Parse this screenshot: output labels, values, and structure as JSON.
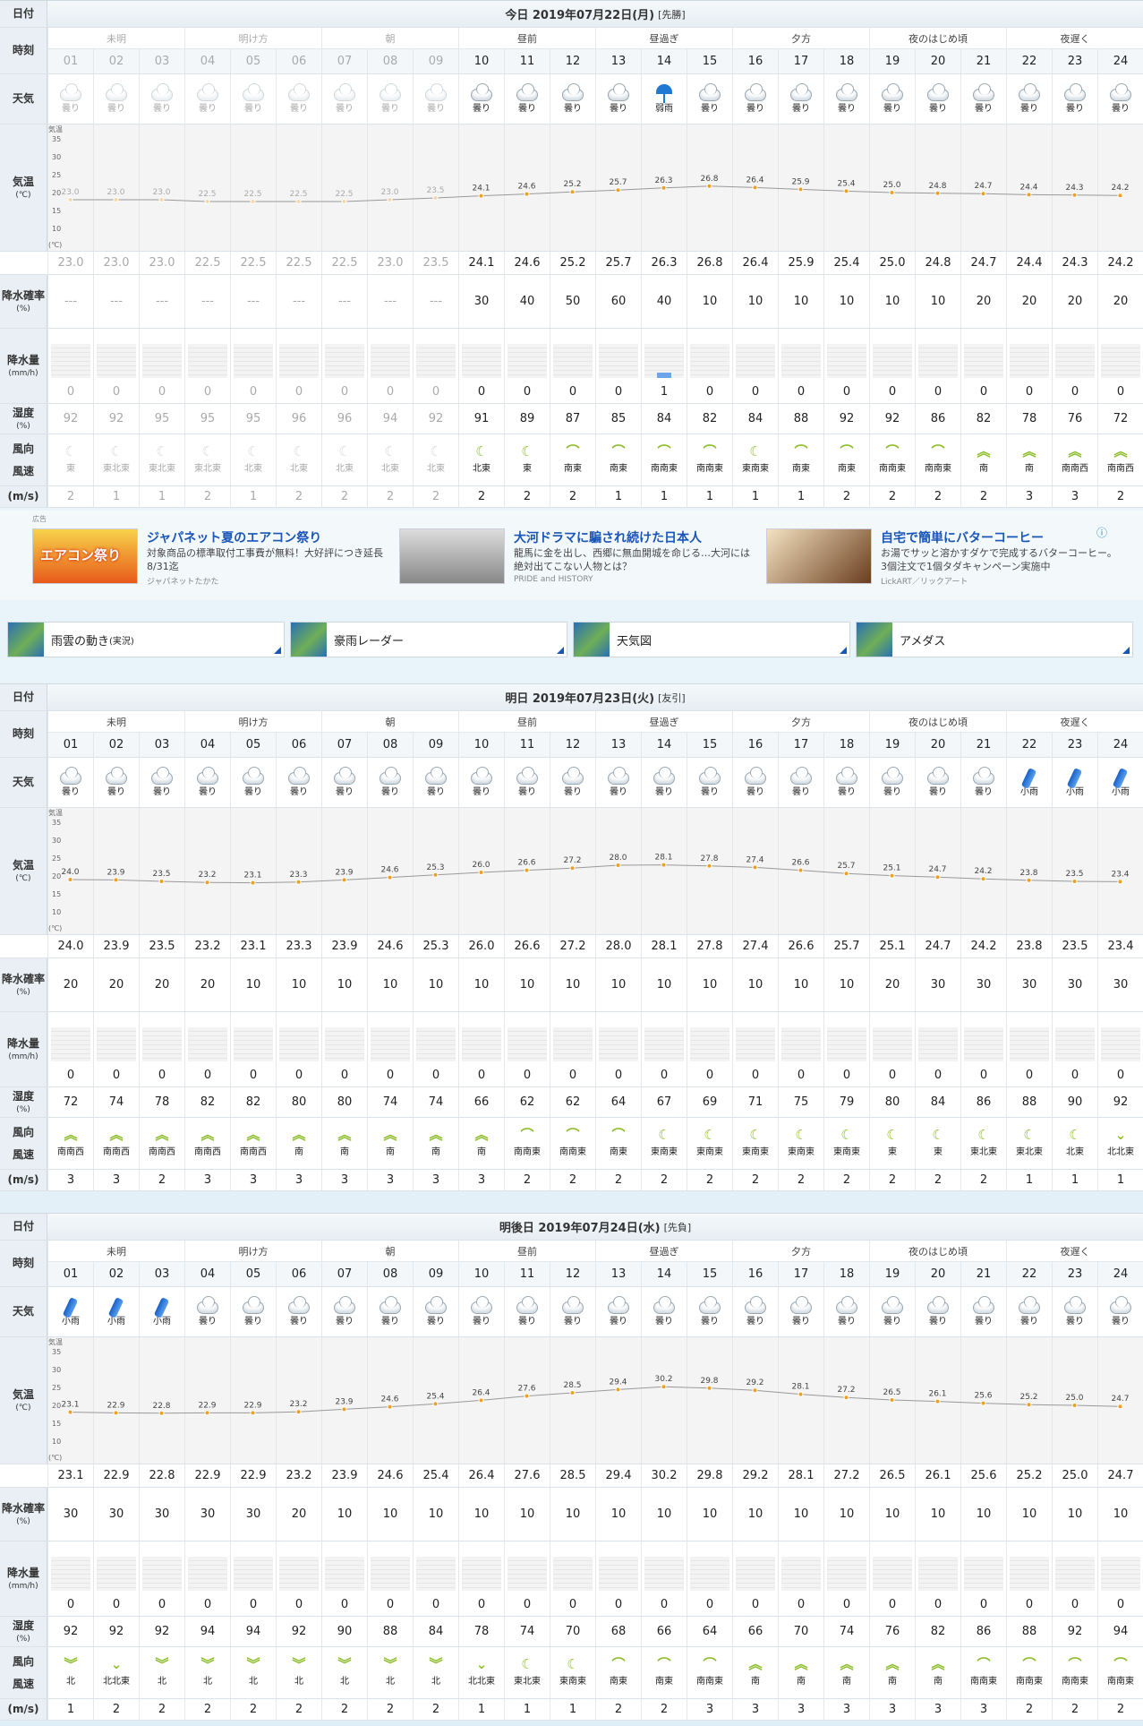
{
  "labels": {
    "date": "日付",
    "hour": "時刻",
    "weather": "天気",
    "temp": "気温",
    "temp_unit": "(℃)",
    "axis_title": "気温",
    "axis_unit": "(℃)",
    "pop": "降水確率",
    "pop_unit": "(%)",
    "rain": "降水量",
    "rain_unit": "(mm/h)",
    "humid": "湿度",
    "humid_unit": "(%)",
    "wdir": "風向",
    "wspd": "風速",
    "wunit": "(m/s)"
  },
  "periods": [
    "未明",
    "明け方",
    "朝",
    "昼前",
    "昼過ぎ",
    "夕方",
    "夜のはじめ頃",
    "夜遅く"
  ],
  "hours": [
    "01",
    "02",
    "03",
    "04",
    "05",
    "06",
    "07",
    "08",
    "09",
    "10",
    "11",
    "12",
    "13",
    "14",
    "15",
    "16",
    "17",
    "18",
    "19",
    "20",
    "21",
    "22",
    "23",
    "24"
  ],
  "axis_ticks": [
    "35",
    "30",
    "25",
    "20",
    "15",
    "10"
  ],
  "days": [
    {
      "title": "今日 2019年07月22日(月)",
      "rokuyo": "[先勝]",
      "past_hours": 9,
      "weather": [
        "曇り",
        "曇り",
        "曇り",
        "曇り",
        "曇り",
        "曇り",
        "曇り",
        "曇り",
        "曇り",
        "曇り",
        "曇り",
        "曇り",
        "曇り",
        "弱雨",
        "曇り",
        "曇り",
        "曇り",
        "曇り",
        "曇り",
        "曇り",
        "曇り",
        "曇り",
        "曇り",
        "曇り"
      ],
      "temp": [
        "23.0",
        "23.0",
        "23.0",
        "22.5",
        "22.5",
        "22.5",
        "22.5",
        "23.0",
        "23.5",
        "24.1",
        "24.6",
        "25.2",
        "25.7",
        "26.3",
        "26.8",
        "26.4",
        "25.9",
        "25.4",
        "25.0",
        "24.8",
        "24.7",
        "24.4",
        "24.3",
        "24.2"
      ],
      "pop": [
        "---",
        "---",
        "---",
        "---",
        "---",
        "---",
        "---",
        "---",
        "---",
        "30",
        "40",
        "50",
        "60",
        "40",
        "10",
        "10",
        "10",
        "10",
        "10",
        "10",
        "20",
        "20",
        "20",
        "20"
      ],
      "rain": [
        "0",
        "0",
        "0",
        "0",
        "0",
        "0",
        "0",
        "0",
        "0",
        "0",
        "0",
        "0",
        "0",
        "1",
        "0",
        "0",
        "0",
        "0",
        "0",
        "0",
        "0",
        "0",
        "0",
        "0"
      ],
      "humid": [
        "92",
        "92",
        "95",
        "95",
        "95",
        "96",
        "96",
        "94",
        "92",
        "91",
        "89",
        "87",
        "85",
        "84",
        "82",
        "84",
        "88",
        "92",
        "92",
        "86",
        "82",
        "78",
        "76",
        "72"
      ],
      "wdir": [
        "東",
        "東北東",
        "東北東",
        "東北東",
        "北東",
        "北東",
        "北東",
        "北東",
        "北東",
        "北東",
        "東",
        "南東",
        "南東",
        "南南東",
        "南南東",
        "東南東",
        "南東",
        "南東",
        "南南東",
        "南南東",
        "南",
        "南",
        "南南西",
        "南南西"
      ],
      "wspd": [
        "2",
        "1",
        "1",
        "2",
        "1",
        "2",
        "2",
        "2",
        "2",
        "2",
        "2",
        "2",
        "1",
        "1",
        "1",
        "1",
        "1",
        "2",
        "2",
        "2",
        "2",
        "3",
        "3",
        "2"
      ]
    },
    {
      "title": "明日 2019年07月23日(火)",
      "rokuyo": "[友引]",
      "past_hours": 0,
      "weather": [
        "曇り",
        "曇り",
        "曇り",
        "曇り",
        "曇り",
        "曇り",
        "曇り",
        "曇り",
        "曇り",
        "曇り",
        "曇り",
        "曇り",
        "曇り",
        "曇り",
        "曇り",
        "曇り",
        "曇り",
        "曇り",
        "曇り",
        "曇り",
        "曇り",
        "小雨",
        "小雨",
        "小雨"
      ],
      "temp": [
        "24.0",
        "23.9",
        "23.5",
        "23.2",
        "23.1",
        "23.3",
        "23.9",
        "24.6",
        "25.3",
        "26.0",
        "26.6",
        "27.2",
        "28.0",
        "28.1",
        "27.8",
        "27.4",
        "26.6",
        "25.7",
        "25.1",
        "24.7",
        "24.2",
        "23.8",
        "23.5",
        "23.4"
      ],
      "pop": [
        "20",
        "20",
        "20",
        "20",
        "10",
        "10",
        "10",
        "10",
        "10",
        "10",
        "10",
        "10",
        "10",
        "10",
        "10",
        "10",
        "10",
        "10",
        "20",
        "30",
        "30",
        "30",
        "30",
        "30"
      ],
      "rain": [
        "0",
        "0",
        "0",
        "0",
        "0",
        "0",
        "0",
        "0",
        "0",
        "0",
        "0",
        "0",
        "0",
        "0",
        "0",
        "0",
        "0",
        "0",
        "0",
        "0",
        "0",
        "0",
        "0",
        "0"
      ],
      "humid": [
        "72",
        "74",
        "78",
        "82",
        "82",
        "80",
        "80",
        "74",
        "74",
        "66",
        "62",
        "62",
        "64",
        "67",
        "69",
        "71",
        "75",
        "79",
        "80",
        "84",
        "86",
        "88",
        "90",
        "92"
      ],
      "wdir": [
        "南南西",
        "南南西",
        "南南西",
        "南南西",
        "南南西",
        "南",
        "南",
        "南",
        "南",
        "南",
        "南南東",
        "南南東",
        "南東",
        "東南東",
        "東南東",
        "東南東",
        "東南東",
        "東南東",
        "東",
        "東",
        "東北東",
        "東北東",
        "北東",
        "北北東"
      ],
      "wspd": [
        "3",
        "3",
        "2",
        "3",
        "3",
        "3",
        "3",
        "3",
        "3",
        "3",
        "2",
        "2",
        "2",
        "2",
        "2",
        "2",
        "2",
        "2",
        "2",
        "2",
        "2",
        "1",
        "1",
        "1"
      ]
    },
    {
      "title": "明後日 2019年07月24日(水)",
      "rokuyo": "[先負]",
      "past_hours": 0,
      "weather": [
        "小雨",
        "小雨",
        "小雨",
        "曇り",
        "曇り",
        "曇り",
        "曇り",
        "曇り",
        "曇り",
        "曇り",
        "曇り",
        "曇り",
        "曇り",
        "曇り",
        "曇り",
        "曇り",
        "曇り",
        "曇り",
        "曇り",
        "曇り",
        "曇り",
        "曇り",
        "曇り",
        "曇り"
      ],
      "temp": [
        "23.1",
        "22.9",
        "22.8",
        "22.9",
        "22.9",
        "23.2",
        "23.9",
        "24.6",
        "25.4",
        "26.4",
        "27.6",
        "28.5",
        "29.4",
        "30.2",
        "29.8",
        "29.2",
        "28.1",
        "27.2",
        "26.5",
        "26.1",
        "25.6",
        "25.2",
        "25.0",
        "24.7"
      ],
      "pop": [
        "30",
        "30",
        "30",
        "30",
        "30",
        "20",
        "10",
        "10",
        "10",
        "10",
        "10",
        "10",
        "10",
        "10",
        "10",
        "10",
        "10",
        "10",
        "10",
        "10",
        "10",
        "10",
        "10",
        "10"
      ],
      "rain": [
        "0",
        "0",
        "0",
        "0",
        "0",
        "0",
        "0",
        "0",
        "0",
        "0",
        "0",
        "0",
        "0",
        "0",
        "0",
        "0",
        "0",
        "0",
        "0",
        "0",
        "0",
        "0",
        "0",
        "0"
      ],
      "humid": [
        "92",
        "92",
        "92",
        "94",
        "94",
        "92",
        "90",
        "88",
        "84",
        "78",
        "74",
        "70",
        "68",
        "66",
        "64",
        "66",
        "70",
        "74",
        "76",
        "82",
        "86",
        "88",
        "92",
        "94"
      ],
      "wdir": [
        "北",
        "北北東",
        "北",
        "北",
        "北",
        "北",
        "北",
        "北",
        "北",
        "北北東",
        "東北東",
        "東南東",
        "南東",
        "南東",
        "南南東",
        "南",
        "南",
        "南",
        "南",
        "南",
        "南南東",
        "南南東",
        "南南東",
        "南南東"
      ],
      "wspd": [
        "1",
        "2",
        "2",
        "2",
        "2",
        "2",
        "2",
        "2",
        "2",
        "1",
        "1",
        "1",
        "2",
        "2",
        "3",
        "3",
        "3",
        "3",
        "3",
        "3",
        "3",
        "2",
        "2",
        "2"
      ]
    }
  ],
  "ads": {
    "label": "広告",
    "items": [
      {
        "title": "ジャパネット夏のエアコン祭り",
        "desc": "対象商品の標準取付工事費が無料！大好評につき延長 8/31迄",
        "source": "ジャパネットたかた",
        "thumb_text": "エアコン祭り"
      },
      {
        "title": "大河ドラマに騙され続けた日本人",
        "desc": "龍馬に金を出し、西郷に無血開城を命じる…大河には絶対出てこない人物とは？",
        "source": "PRIDE and HISTORY"
      },
      {
        "title": "自宅で簡単にバターコーヒー",
        "desc": "お湯でサッと溶かすダケで完成するバターコーヒー。3個注文で1個タダキャンペーン実施中",
        "source": "LickART／リックアート"
      }
    ]
  },
  "links": [
    {
      "label": "雨雲の動き",
      "sub": "(実況)"
    },
    {
      "label": "豪雨レーダー",
      "sub": ""
    },
    {
      "label": "天気図",
      "sub": ""
    },
    {
      "label": "アメダス",
      "sub": ""
    }
  ]
}
